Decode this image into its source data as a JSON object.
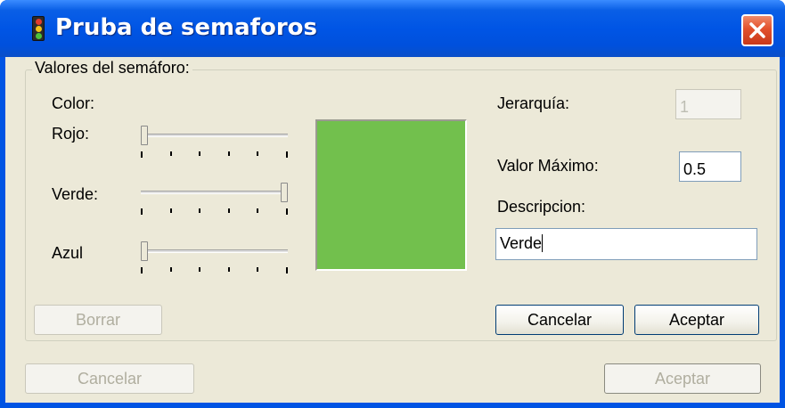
{
  "window": {
    "title": "Pruba de semaforos"
  },
  "group": {
    "legend": "Valores del semáforo:"
  },
  "labels": {
    "color": "Color:",
    "rojo": "Rojo:",
    "verde": "Verde:",
    "azul": "Azul",
    "jerarquia": "Jerarquía:",
    "valor_maximo": "Valor Máximo:",
    "descripcion": "Descripcion:"
  },
  "sliders": {
    "rojo": {
      "min": 0,
      "max": 255,
      "value": 0,
      "tick_count": 6
    },
    "verde": {
      "min": 0,
      "max": 255,
      "value": 255,
      "tick_count": 6
    },
    "azul": {
      "min": 0,
      "max": 255,
      "value": 0,
      "tick_count": 6
    }
  },
  "color_preview": "#72c04d",
  "fields": {
    "jerarquia": "1",
    "valor_maximo": "0.5",
    "descripcion": "Verde"
  },
  "buttons": {
    "borrar": "Borrar",
    "inner_cancelar": "Cancelar",
    "inner_aceptar": "Aceptar",
    "cancelar": "Cancelar",
    "aceptar": "Aceptar"
  },
  "colors": {
    "traffic_red": "#e23b2c",
    "traffic_yellow": "#f2c318",
    "traffic_green": "#4cc23a"
  }
}
